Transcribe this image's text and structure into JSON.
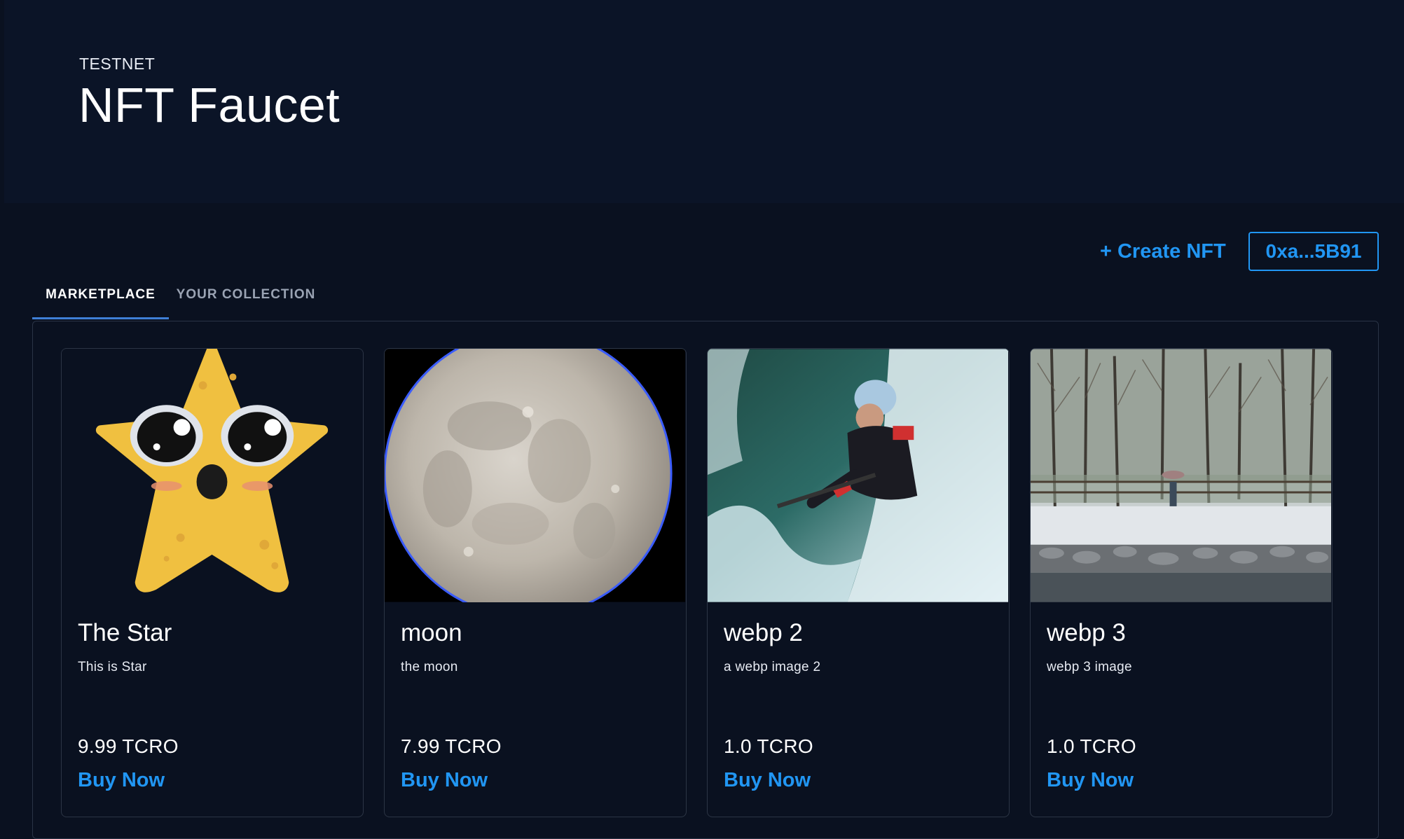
{
  "header": {
    "network_label": "TESTNET",
    "title": "NFT Faucet"
  },
  "toolbar": {
    "create_label": "+ Create NFT",
    "wallet_label": "0xa...5B91"
  },
  "tabs": [
    {
      "label": "MARKETPLACE",
      "selected": true
    },
    {
      "label": "YOUR COLLECTION",
      "selected": false
    }
  ],
  "nfts": [
    {
      "name": "The Star",
      "description": "This is Star",
      "price": "9.99 TCRO",
      "buy_label": "Buy Now",
      "image": "star-image"
    },
    {
      "name": "moon",
      "description": "the moon",
      "price": "7.99 TCRO",
      "buy_label": "Buy Now",
      "image": "moon-image"
    },
    {
      "name": "webp 2",
      "description": "a webp image 2",
      "price": "1.0 TCRO",
      "buy_label": "Buy Now",
      "image": "kayaker-image"
    },
    {
      "name": "webp 3",
      "description": "webp 3 image",
      "price": "1.0 TCRO",
      "buy_label": "Buy Now",
      "image": "winter-park-image"
    }
  ],
  "colors": {
    "background": "#0a1120",
    "accent": "#2196f3",
    "tab_indicator": "#3f7fd6"
  }
}
